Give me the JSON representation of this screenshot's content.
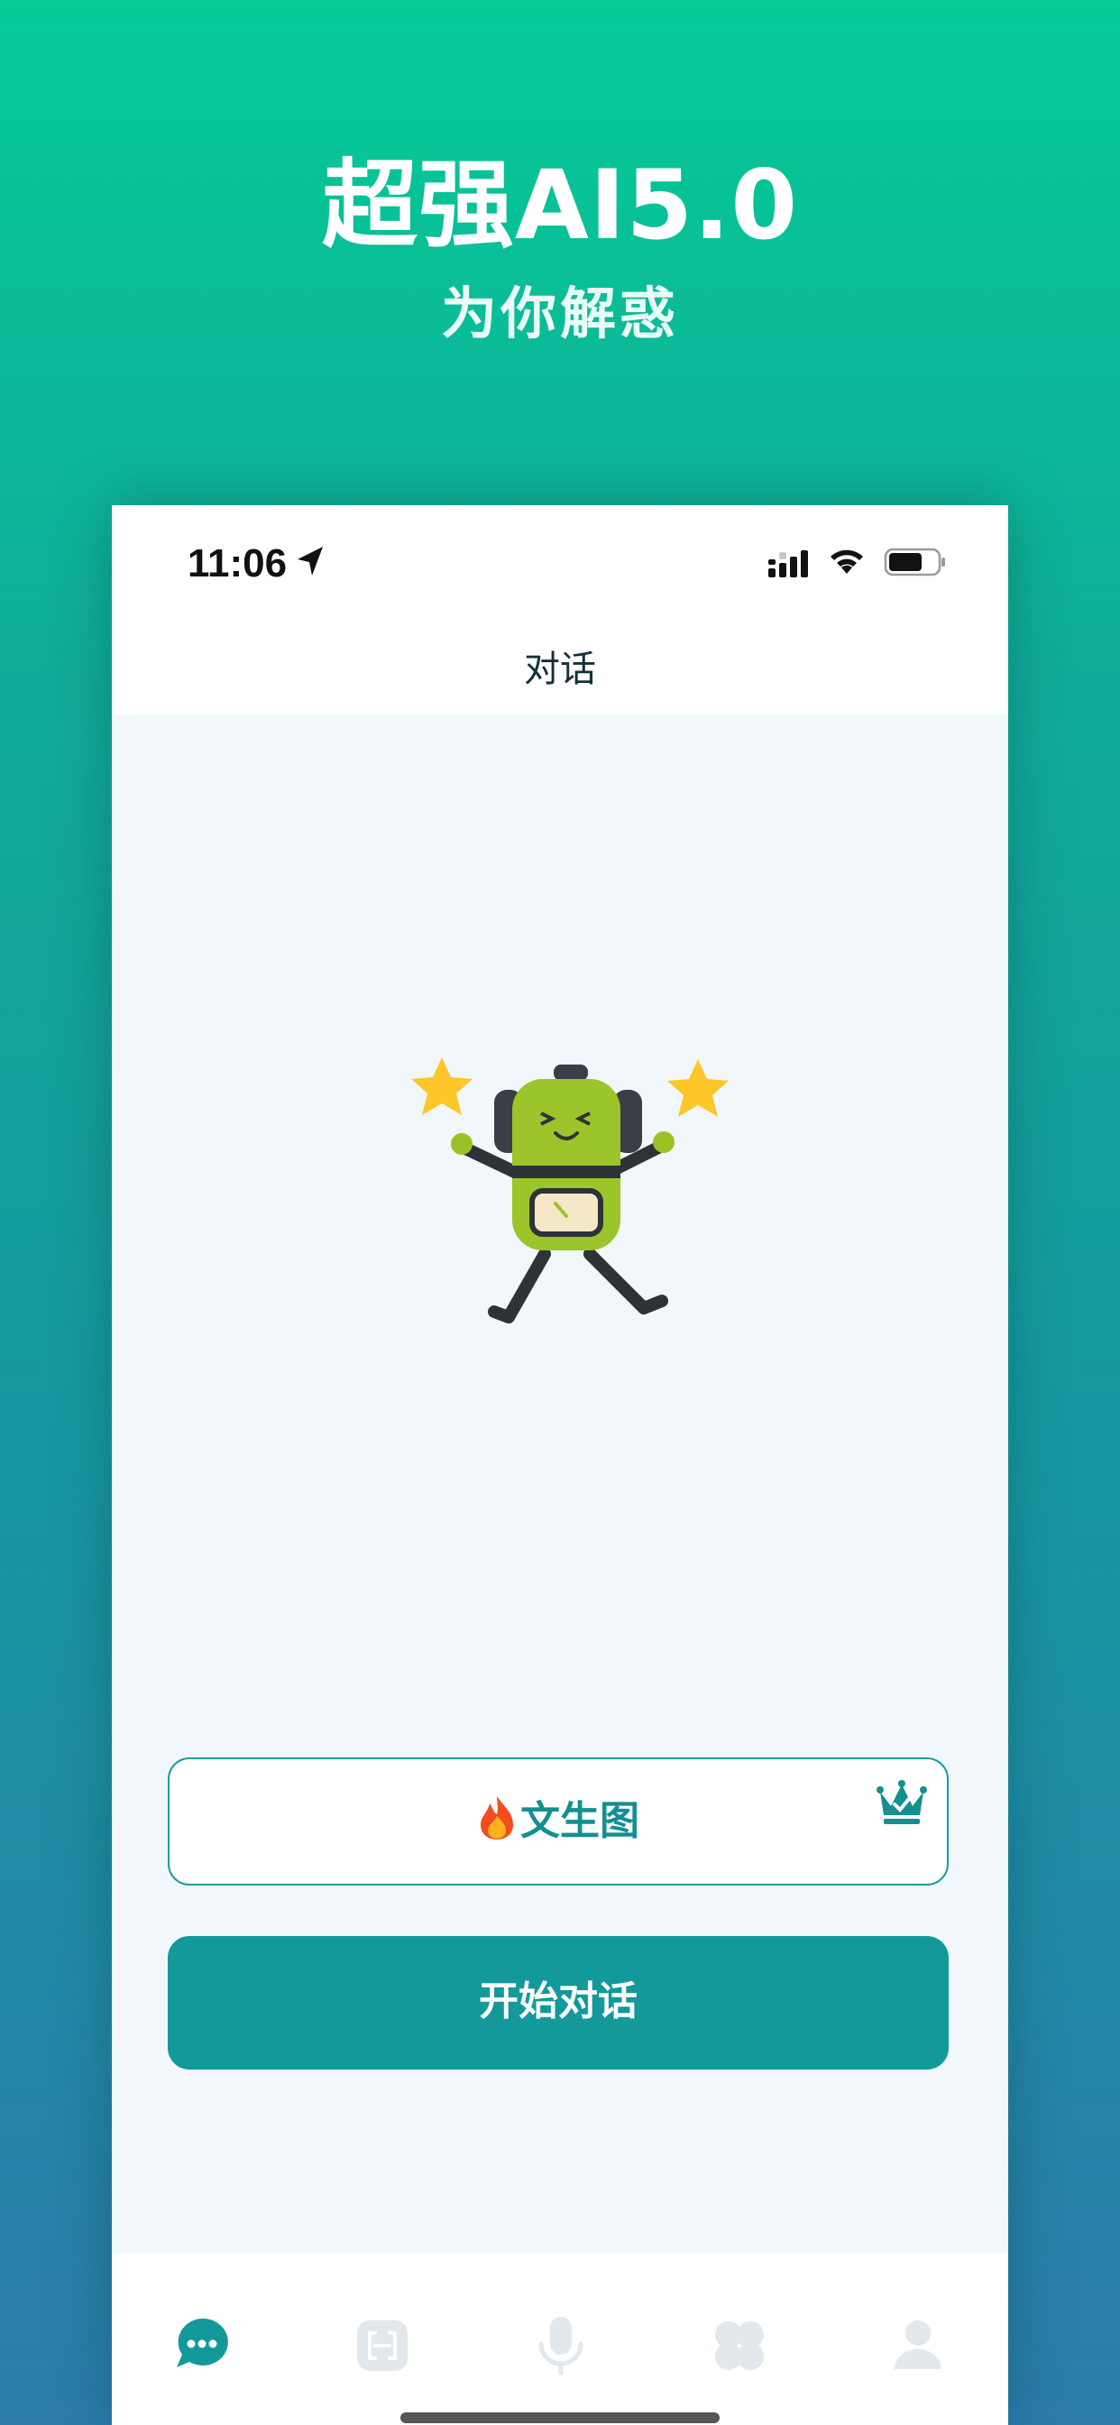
{
  "promo": {
    "headline": "超强AI5.0",
    "subheadline": "为你解惑"
  },
  "status_bar": {
    "time": "11:06",
    "icons": [
      "location-arrow-icon",
      "signal-icon",
      "wifi-icon",
      "battery-icon"
    ]
  },
  "nav": {
    "title": "对话"
  },
  "main": {
    "illustration": "robot-mascot",
    "txt2img_button": {
      "label": "文生图",
      "prefix_icon": "fire-icon",
      "badge_icon": "crown-icon"
    },
    "start_button": {
      "label": "开始对话"
    }
  },
  "tabbar": {
    "tabs": [
      {
        "icon": "chat-bubble-icon",
        "active": true
      },
      {
        "icon": "scan-icon",
        "active": false
      },
      {
        "icon": "microphone-icon",
        "active": false
      },
      {
        "icon": "apps-grid-icon",
        "active": false
      },
      {
        "icon": "profile-icon",
        "active": false
      }
    ]
  },
  "colors": {
    "accent": "#14999b",
    "bg_top": "#05cb97",
    "bg_bottom": "#2c7bab",
    "screen_bg": "#f1f7fa",
    "inactive_icon": "#e2e8eb"
  }
}
